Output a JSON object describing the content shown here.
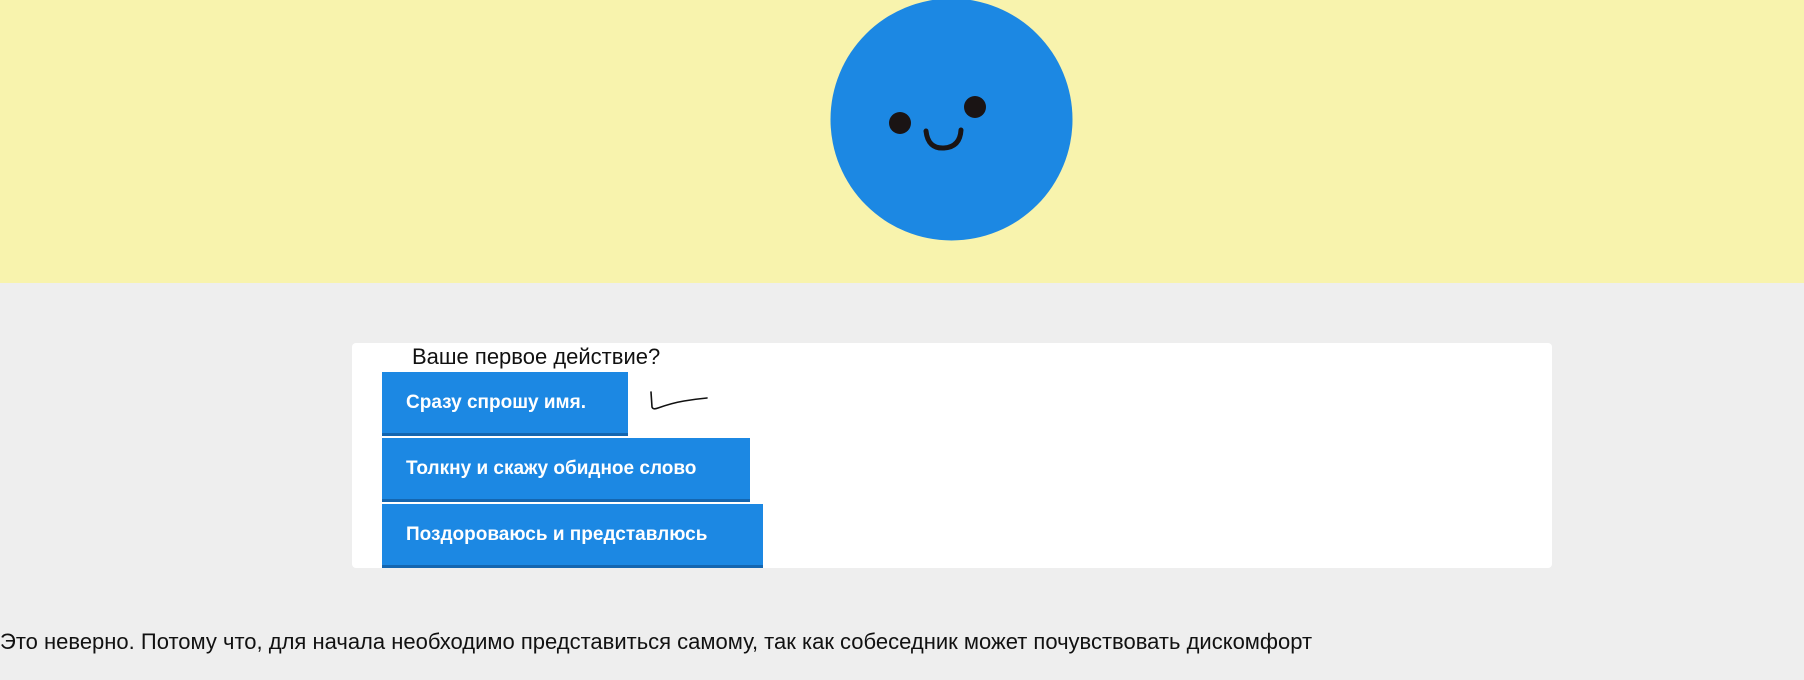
{
  "mascot": {
    "icon": "smiley-face-icon",
    "face_color": "#1c88e3",
    "feature_color": "#1a1414"
  },
  "hero": {
    "background_color": "#f8f3ad"
  },
  "quiz": {
    "question": "Ваше первое действие?",
    "options": [
      {
        "label": "Сразу спрошу имя."
      },
      {
        "label": "Толкну и скажу обидное слово"
      },
      {
        "label": "Поздороваюсь и представлюсь"
      }
    ],
    "button_color": "#1c88e3"
  },
  "feedback": {
    "text": "Это неверно. Потому что, для начала необходимо представиться самому, так как собеседник может почувствовать дискомфорт"
  }
}
